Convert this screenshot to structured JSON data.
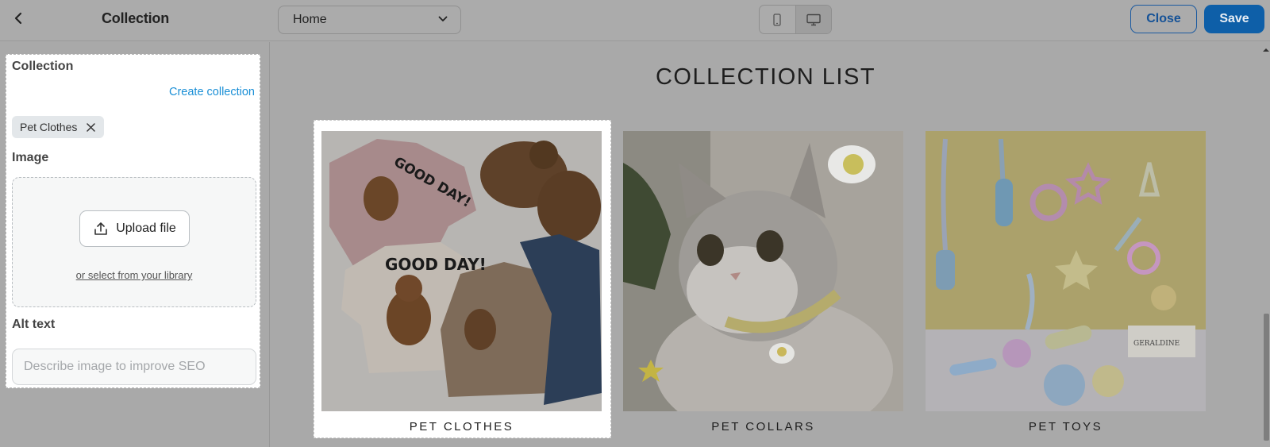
{
  "topbar": {
    "title": "Collection",
    "page_select_value": "Home",
    "close_label": "Close",
    "save_label": "Save"
  },
  "panel": {
    "collection_heading": "Collection",
    "create_collection_link": "Create collection",
    "selected_tag": "Pet Clothes",
    "image_heading": "Image",
    "upload_button_label": "Upload file",
    "library_link": "or select from your library",
    "alt_text_heading": "Alt text",
    "alt_text_placeholder": "Describe image to improve SEO",
    "alt_text_value": ""
  },
  "preview": {
    "section_title": "COLLECTION LIST",
    "cards": [
      {
        "label": "PET CLOTHES",
        "image": "pet-clothes-photo"
      },
      {
        "label": "PET COLLARS",
        "image": "pet-collars-photo"
      },
      {
        "label": "PET TOYS",
        "image": "pet-toys-photo"
      }
    ]
  },
  "colors": {
    "accent_link": "#1a8fd6",
    "save_button": "#0e5fa8",
    "close_border": "#1b5aa0",
    "overlay_grey": "#a9a9a9"
  },
  "icons": [
    "chevron-left-icon",
    "chevron-down-icon",
    "mobile-icon",
    "desktop-icon",
    "close-icon",
    "upload-icon"
  ]
}
